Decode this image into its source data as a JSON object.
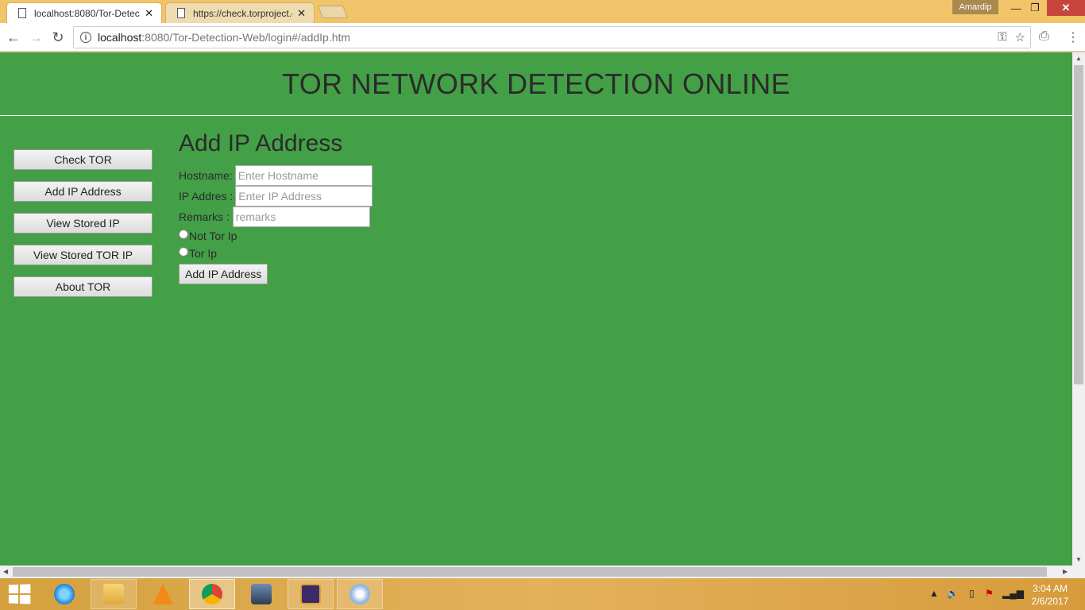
{
  "browser": {
    "tabs": [
      {
        "title": "localhost:8080/Tor-Detec",
        "active": true
      },
      {
        "title": "https://check.torproject.o",
        "active": false
      }
    ],
    "profile": "Amardip",
    "url_host": "localhost",
    "url_path": ":8080/Tor-Detection-Web/login#/addIp.htm"
  },
  "page": {
    "header_title": "TOR NETWORK DETECTION ONLINE",
    "sidebar": [
      {
        "label": "Check TOR"
      },
      {
        "label": "Add IP Address"
      },
      {
        "label": "View Stored IP"
      },
      {
        "label": "View Stored TOR IP"
      },
      {
        "label": "About TOR"
      }
    ],
    "form": {
      "heading": "Add IP Address",
      "hostname_label": "Hostname:",
      "hostname_placeholder": "Enter Hostname",
      "ip_label": "IP Addres :",
      "ip_placeholder": "Enter IP Address",
      "remarks_label": "Remarks :",
      "remarks_placeholder": "remarks",
      "radio_not_tor": "Not Tor Ip",
      "radio_tor": "Tor Ip",
      "submit_label": "Add IP Address"
    }
  },
  "taskbar": {
    "clock_time": "3:04 AM",
    "clock_date": "2/6/2017",
    "icons": [
      "ie-icon",
      "file-explorer-icon",
      "vlc-icon",
      "chrome-icon",
      "media-app-icon",
      "java-ee-ide-icon",
      "paint-icon"
    ]
  },
  "colors": {
    "page_background": "#43a047",
    "titlebar": "#f2c46a"
  }
}
